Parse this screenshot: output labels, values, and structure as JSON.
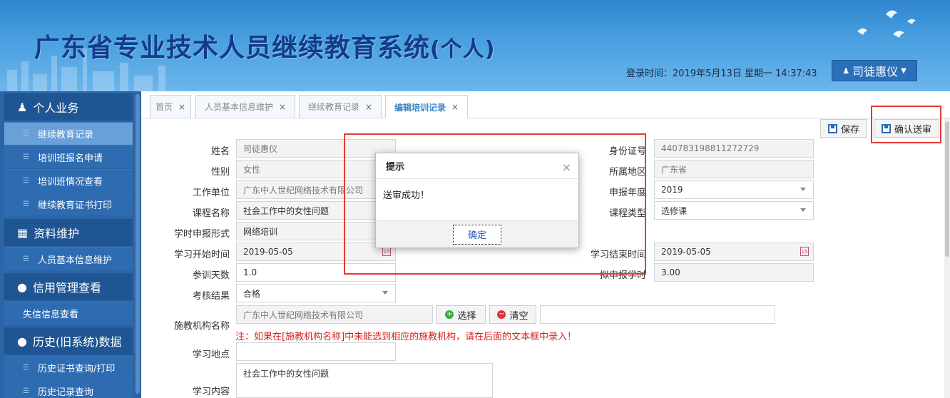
{
  "header": {
    "title": "广东省专业技术人员继续教育系统",
    "title_suffix": "(个人)",
    "login_info": "登录时间：2019年5月13日  星期一  14:37:43",
    "user_name": "司徒惠仪"
  },
  "sidebar": {
    "groups": [
      {
        "label": "个人业务",
        "items": [
          "继续教育记录",
          "培训班报名申请",
          "培训班情况查看",
          "继续教育证书打印"
        ]
      },
      {
        "label": "资料维护",
        "items": [
          "人员基本信息维护"
        ]
      },
      {
        "label": "信用管理查看",
        "items": [
          "失信信息查看"
        ]
      },
      {
        "label": "历史(旧系统)数据",
        "items": [
          "历史证书查询/打印",
          "历史记录查询"
        ]
      }
    ]
  },
  "tabs": [
    "首页",
    "人员基本信息维护",
    "继续教育记录",
    "编辑培训记录"
  ],
  "toolbar": {
    "save": "保存",
    "submit": "确认送审"
  },
  "form": {
    "name_label": "姓名",
    "name": "司徒惠仪",
    "gender_label": "性别",
    "gender": "女性",
    "employer_label": "工作单位",
    "employer": "广东中人世纪网络技术有限公司",
    "course_label": "课程名称",
    "course": "社会工作中的女性问题",
    "mode_label": "学时申报形式",
    "mode": "网络培训",
    "start_label": "学习开始时间",
    "start": "2019-05-05",
    "days_label": "参训天数",
    "days": "1.0",
    "result_label": "考核结果",
    "result": "合格",
    "institution_label": "施教机构名称",
    "institution": "广东中人世纪网络技术有限公司",
    "select_btn": "选择",
    "clear_btn": "清空",
    "note": "注：如果在[施教机构名称]中未能选到相应的施教机构，请在后面的文本框中录入！",
    "place_label": "学习地点",
    "place": "",
    "content_label": "学习内容",
    "content": "社会工作中的女性问题",
    "id_label": "身份证号",
    "id": "440783198811272729",
    "region_label": "所属地区",
    "region": "广东省",
    "year_label": "申报年度",
    "year": "2019",
    "type_label": "课程类型",
    "type": "选修课",
    "end_label": "学习结束时间",
    "end": "2019-05-05",
    "hours_label": "拟申报学时",
    "hours": "3.00"
  },
  "dialog": {
    "title": "提示",
    "message": "送审成功！",
    "ok": "确定"
  }
}
